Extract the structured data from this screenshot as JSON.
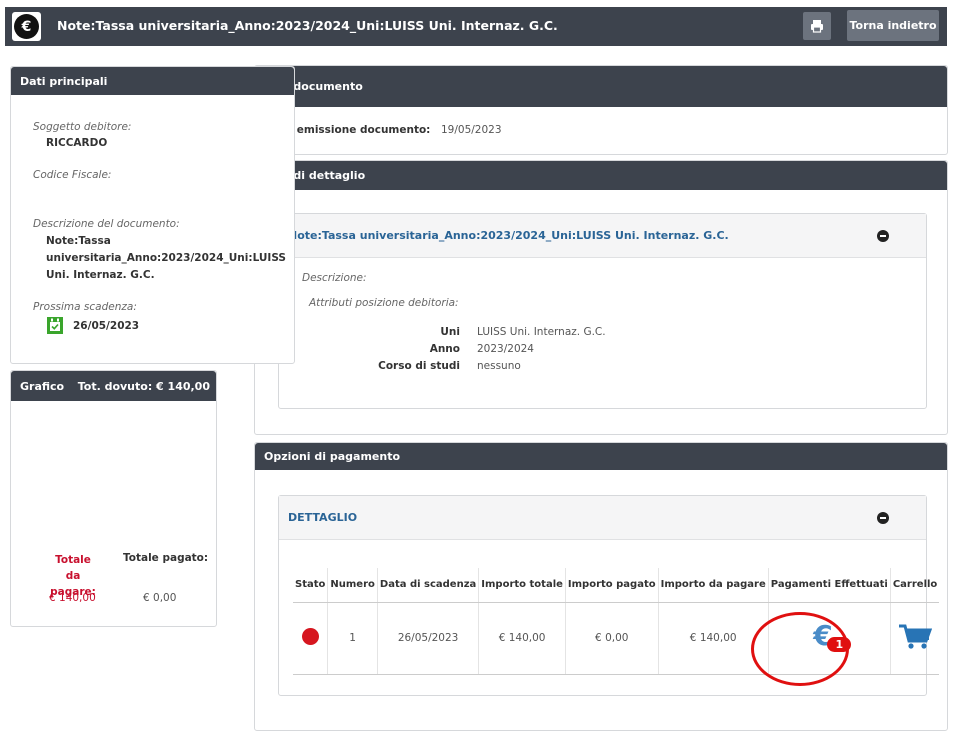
{
  "header": {
    "title": "Note:Tassa universitaria_Anno:2023/2024_Uni:LUISS Uni. Internaz. G.C.",
    "back_label": "Torna indietro"
  },
  "dati_principali": {
    "title": "Dati principali",
    "soggetto_label": "Soggetto debitore:",
    "soggetto_value": "RICCARDO",
    "cf_label": "Codice Fiscale:",
    "descr_label": "Descrizione del documento:",
    "descr_value_1": "Note:Tassa",
    "descr_value_2": "universitaria_Anno:2023/2024_Uni:LUISS",
    "descr_value_3": "Uni. Internaz. G.C.",
    "scadenza_label": "Prossima scadenza:",
    "scadenza_value": "26/05/2023"
  },
  "grafico": {
    "title": "Grafico",
    "tot_dovuto": "Tot. dovuto:  € 140,00",
    "totale_da_pagare_label": "Totale da pagare:",
    "totale_pagato_label": "Totale pagato:",
    "totale_da_pagare_value": "€ 140,00",
    "totale_pagato_value": "€ 0,00"
  },
  "dati_documento": {
    "title": "Dati documento",
    "emissione_label": "ta emissione documento:",
    "emissione_value": "19/05/2023"
  },
  "dati_dettaglio": {
    "title": "Dati di dettaglio",
    "card_title": "Note:Tassa universitaria_Anno:2023/2024_Uni:LUISS Uni. Internaz. G.C.",
    "descrizione_label": "Descrizione:",
    "attributi_label": "Attributi posizione debitoria:",
    "attributes": [
      {
        "k": "Uni",
        "v": "LUISS Uni. Internaz. G.C."
      },
      {
        "k": "Anno",
        "v": "2023/2024"
      },
      {
        "k": "Corso di studi",
        "v": "nessuno"
      }
    ]
  },
  "opzioni": {
    "title": "Opzioni di pagamento",
    "card_title": "DETTAGLIO",
    "columns": [
      "Stato",
      "Numero",
      "Data di scadenza",
      "Importo totale",
      "Importo pagato",
      "Importo da pagare",
      "Pagamenti Effettuati",
      "Carrello"
    ],
    "row": {
      "numero": "1",
      "scadenza": "26/05/2023",
      "totale": "€ 140,00",
      "pagato": "€ 0,00",
      "da_pagare": "€ 140,00",
      "pagamenti_count": "1"
    }
  }
}
